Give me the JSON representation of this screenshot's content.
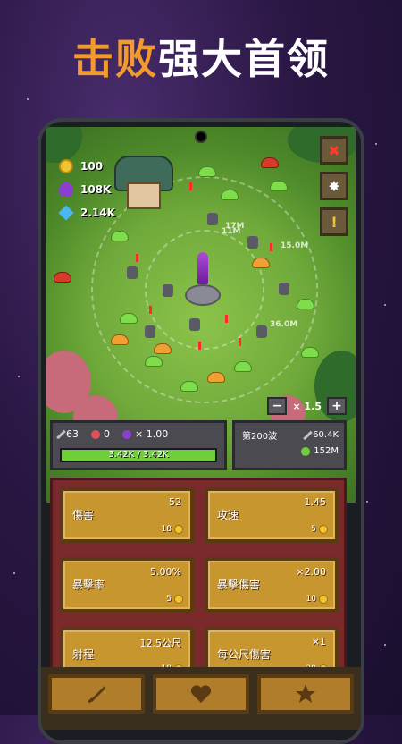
{
  "headline": {
    "part1": "击败",
    "part2": "强大首领"
  },
  "resources": {
    "gold": "100",
    "potion": "108K",
    "gems": "2.14K"
  },
  "side_buttons": {
    "close": "✖",
    "settings": "✸",
    "quest": "!"
  },
  "zoom": {
    "minus": "−",
    "level": "× 1.5",
    "plus": "+"
  },
  "stats": {
    "attack": "63",
    "defense": "0",
    "multiplier": "× 1.00",
    "hp": "3.42K / 3.42K",
    "hp_fraction": 1.0
  },
  "wave": {
    "label": "第200波",
    "attack": "60.4K",
    "hp": "152M"
  },
  "upgrades": [
    {
      "name": "傷害",
      "value": "52",
      "cost": "18"
    },
    {
      "name": "攻速",
      "value": "1.45",
      "cost": "5"
    },
    {
      "name": "暴擊率",
      "value": "5.00%",
      "cost": "5"
    },
    {
      "name": "暴擊傷害",
      "value": "×2.00",
      "cost": "10"
    },
    {
      "name": "射程",
      "value": "12.5公尺",
      "cost": "18"
    },
    {
      "name": "每公尺傷害",
      "value": "×1",
      "cost": "20"
    }
  ],
  "dmg_labels": [
    "17M",
    "15.0M",
    "11M",
    "36.0M"
  ],
  "nav": {
    "sword": "sword-icon",
    "heart": "heart-icon",
    "star": "star-icon"
  }
}
